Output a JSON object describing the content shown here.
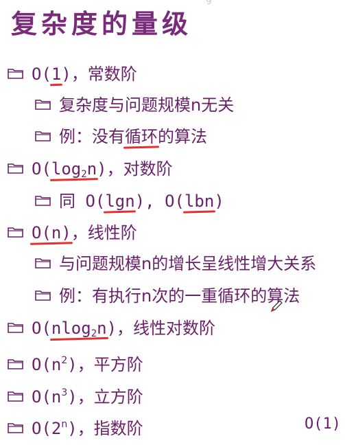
{
  "title": "复杂度的量级",
  "items": {
    "o1": {
      "pre": "O(",
      "arg": "1",
      "post": ")",
      "desc": "，常数阶"
    },
    "o1_sub1": "复杂度与问题规模n无关",
    "o1_sub2": {
      "a": "例：没有",
      "b": "循环",
      "c": "的算法"
    },
    "log": {
      "pre": "O(",
      "a": "log",
      "sub": "2",
      "b": "n",
      "post": ")",
      "desc": "，对数阶"
    },
    "log_sub1": {
      "a": "同 O(",
      "b": "lgn",
      "c": "), O(",
      "d": "lbn",
      "e": ")"
    },
    "on": {
      "pre": "O(",
      "arg": "n",
      "post": ")",
      "desc": "，线性阶"
    },
    "on_sub1": "与问题规模n的增长呈线性增大关系",
    "on_sub2": "例：有执行n次的一重循环的算法",
    "nlog": {
      "pre": "O(",
      "a": "nlog",
      "sub": "2",
      "b": "n",
      "post": ")",
      "desc": "，线性对数阶"
    },
    "n2": {
      "pre": "O(n",
      "sup": "2",
      "post": ")",
      "desc": "，平方阶"
    },
    "n3": {
      "pre": "O(n",
      "sup": "3",
      "post": ")",
      "desc": "，立方阶"
    },
    "exp": {
      "pre": "O(2",
      "sup": "n",
      "post": ")",
      "desc": "，指数阶"
    }
  },
  "side_label": "O(1)",
  "icons": {
    "folder": "folder-icon",
    "pen": "pen-cursor-icon"
  },
  "colors": {
    "text": "#6a1f6a",
    "title": "#7a2a7a",
    "underline": "#e53030"
  }
}
